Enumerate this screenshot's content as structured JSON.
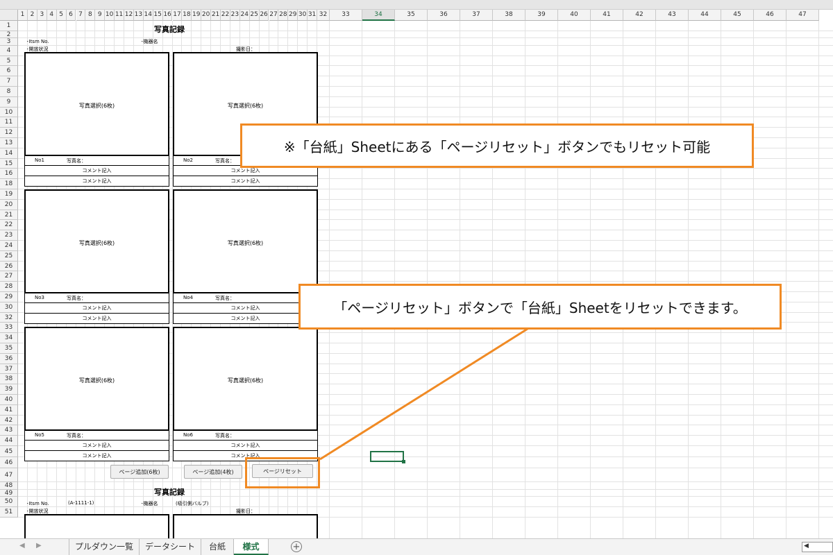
{
  "columns": [
    "1",
    "2",
    "3",
    "4",
    "5",
    "6",
    "7",
    "8",
    "9",
    "10",
    "11",
    "12",
    "13",
    "14",
    "15",
    "16",
    "17",
    "18",
    "19",
    "20",
    "21",
    "22",
    "23",
    "24",
    "25",
    "26",
    "27",
    "28",
    "29",
    "30",
    "31",
    "32",
    "33",
    "34",
    "35",
    "36",
    "37",
    "38",
    "39",
    "40",
    "41",
    "42",
    "43",
    "44",
    "45",
    "46",
    "47"
  ],
  "selected_column": "34",
  "rows": [
    "1",
    "2",
    "3",
    "4",
    "5",
    "6",
    "7",
    "8",
    "9",
    "10",
    "11",
    "12",
    "13",
    "14",
    "15",
    "16",
    "18",
    "19",
    "20",
    "21",
    "22",
    "23",
    "24",
    "25",
    "26",
    "27",
    "28",
    "29",
    "30",
    "32",
    "33",
    "34",
    "35",
    "36",
    "37",
    "38",
    "39",
    "40",
    "41",
    "42",
    "43",
    "44",
    "45",
    "46",
    "47",
    "48",
    "49",
    "50",
    "51"
  ],
  "selected_row": "44",
  "form": {
    "title": "写真記録",
    "item_no_label": "･Itsm No.",
    "equipment_label": "･機器名",
    "status_label": "･開放状況",
    "date_label": "撮影日：",
    "photo_select": "写真選択(6枚)",
    "photo_name_label": "写真名：",
    "comment_label": "コメント記入",
    "photos": [
      {
        "no": "No1"
      },
      {
        "no": "No2"
      },
      {
        "no": "No3"
      },
      {
        "no": "No4"
      },
      {
        "no": "No5"
      },
      {
        "no": "No6"
      }
    ]
  },
  "form2": {
    "title": "写真記録",
    "item_no_label": "･Itsm No.",
    "item_no_value": "(A-1111-1)",
    "equipment_label": "･機器名",
    "equipment_value": "(吸引側バルブ)",
    "status_label": "･開放状況",
    "date_label": "撮影日："
  },
  "buttons": {
    "add_page_6": "ページ追加(6枚)",
    "add_page_4": "ページ追加(4枚)",
    "page_reset": "ページリセット"
  },
  "callouts": {
    "note": "※「台紙」Sheetにある「ページリセット」ボタンでもリセット可能",
    "reset_explain": "「ページリセット」ボタンで「台紙」Sheetをリセットできます。"
  },
  "tabs": [
    {
      "label": "プルダウン一覧"
    },
    {
      "label": "データシート"
    },
    {
      "label": "台紙"
    },
    {
      "label": "様式"
    }
  ],
  "colors": {
    "accent": "#f08a24",
    "excel_green": "#217346"
  }
}
